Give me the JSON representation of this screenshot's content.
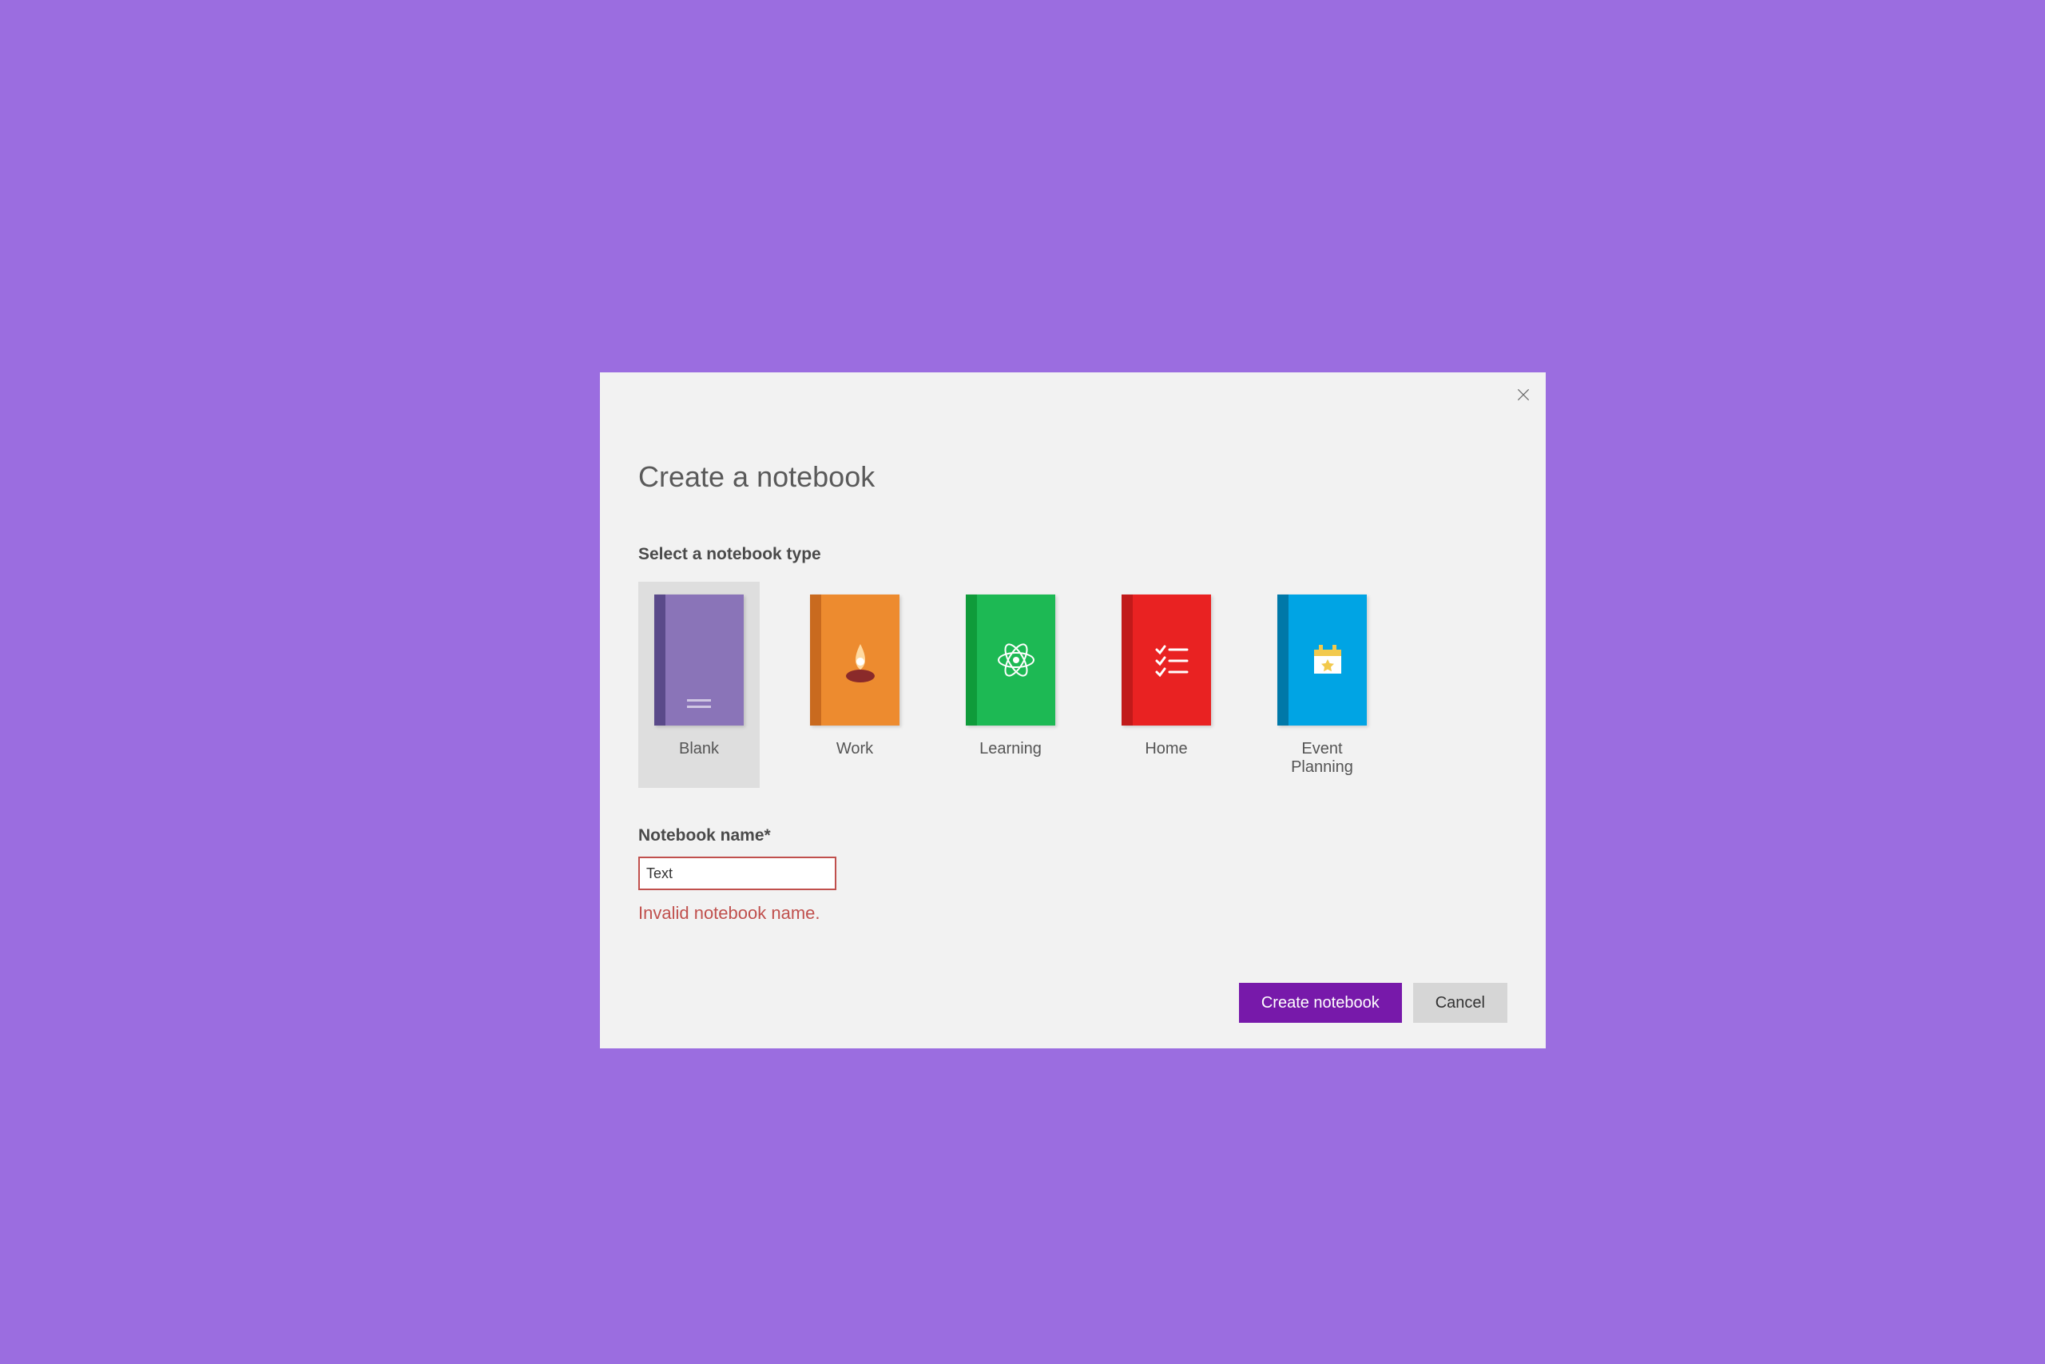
{
  "dialog": {
    "title": "Create a notebook",
    "selectLabel": "Select a notebook type",
    "templates": [
      {
        "id": "blank",
        "label": "Blank",
        "spine": "#5a4a8a",
        "cover": "#8a74b8",
        "selected": true
      },
      {
        "id": "work",
        "label": "Work",
        "spine": "#c96a1f",
        "cover": "#ed8b2f",
        "selected": false
      },
      {
        "id": "learning",
        "label": "Learning",
        "spine": "#0f9b3a",
        "cover": "#1db954",
        "selected": false
      },
      {
        "id": "home",
        "label": "Home",
        "spine": "#c11a1a",
        "cover": "#e92222",
        "selected": false
      },
      {
        "id": "event",
        "label": "Event Planning",
        "spine": "#0078a8",
        "cover": "#00a4e4",
        "selected": false
      }
    ],
    "nameLabel": "Notebook name*",
    "nameValue": "Text",
    "errorMsg": "Invalid notebook name.",
    "createLabel": "Create notebook",
    "cancelLabel": "Cancel"
  }
}
